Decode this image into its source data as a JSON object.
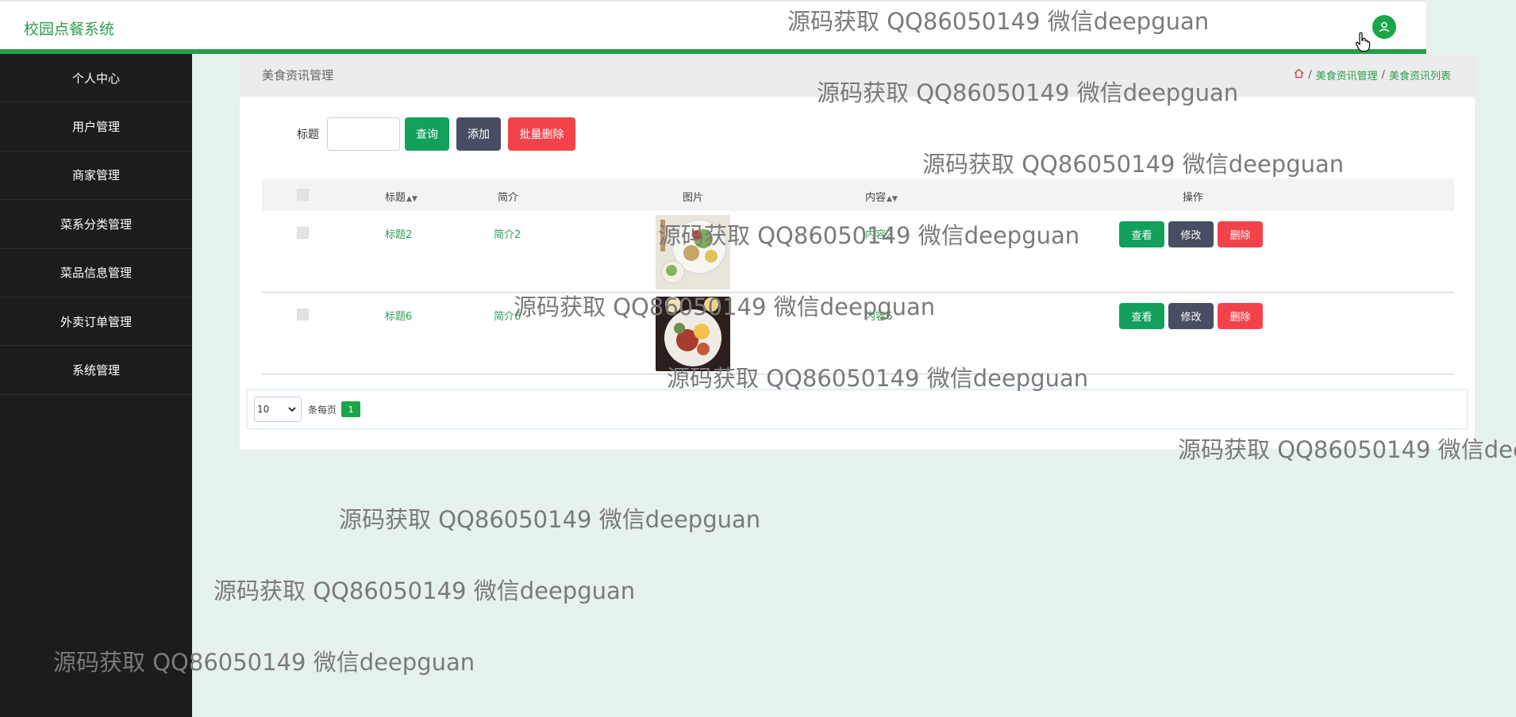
{
  "app": {
    "title": "校园点餐系统"
  },
  "colors": {
    "accent": "#23a046",
    "sidebar": "#1c1c1c",
    "danger": "#f2434a",
    "dark": "#474e63"
  },
  "sidebar": {
    "items": [
      {
        "label": "个人中心"
      },
      {
        "label": "用户管理"
      },
      {
        "label": "商家管理"
      },
      {
        "label": "菜系分类管理"
      },
      {
        "label": "菜品信息管理"
      },
      {
        "label": "外卖订单管理"
      },
      {
        "label": "系统管理"
      }
    ]
  },
  "panel": {
    "title": "美食资讯管理",
    "breadcrumb": [
      "美食资讯管理",
      "美食资讯列表"
    ],
    "search": {
      "label": "标题",
      "value": "",
      "placeholder": ""
    },
    "buttons": {
      "query": "查询",
      "add": "添加",
      "batch_delete": "批量删除"
    }
  },
  "table": {
    "columns": [
      "标题",
      "简介",
      "图片",
      "内容",
      "操作"
    ],
    "sortable": [
      "标题",
      "内容"
    ],
    "rows": [
      {
        "title": "标题2",
        "intro": "简介2",
        "content": "内容2",
        "image": "salad-plate"
      },
      {
        "title": "标题6",
        "intro": "简介6",
        "content": "内容6",
        "image": "breakfast-plate"
      }
    ],
    "actions": {
      "view": "查看",
      "edit": "修改",
      "delete": "删除"
    }
  },
  "pagination": {
    "page_size": "10",
    "per_page_label": "条每页",
    "current_page": "1"
  },
  "watermark": "源码获取 QQ86050149 微信deepguan"
}
